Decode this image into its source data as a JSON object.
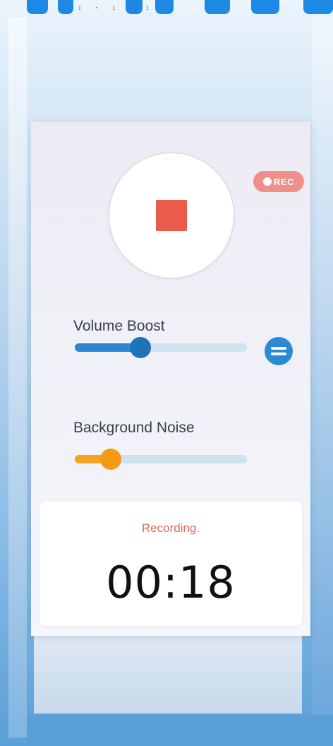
{
  "recorder": {
    "rec_badge": "REC",
    "volume_boost": {
      "label": "Volume Boost",
      "level_percent": 38
    },
    "background_noise": {
      "label": "Background Noise",
      "level_percent": 21
    },
    "status": "Recording.",
    "timer": "00:18"
  },
  "colors": {
    "record_stop": "#ea5b4c",
    "rec_badge": "#ee8f8b",
    "volume_slider": "#2a87d0",
    "noise_slider": "#f7a321",
    "status_text": "#e06a60"
  },
  "icons": {
    "record": "stop-square-icon",
    "menu": "menu-icon",
    "rec_indicator": "dot-icon"
  }
}
